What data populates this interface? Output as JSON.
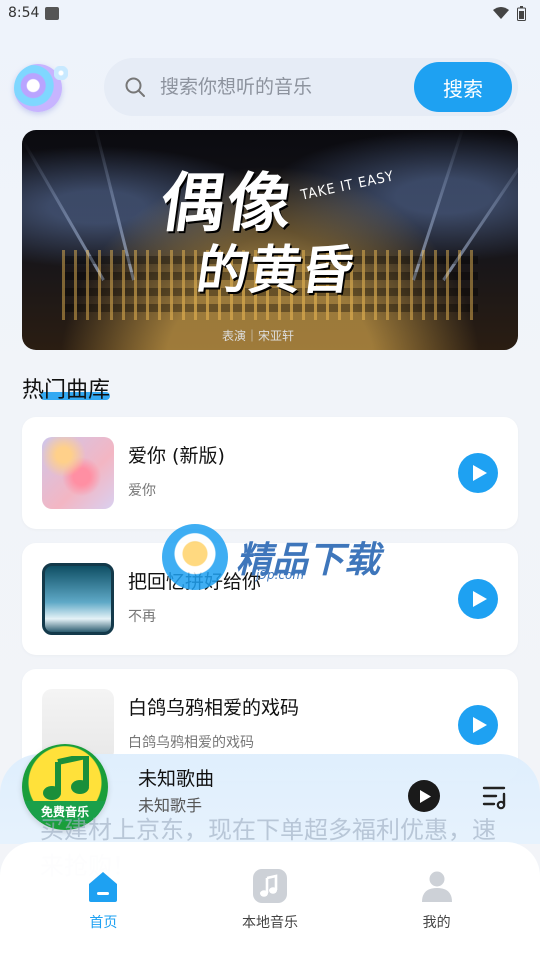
{
  "status_bar": {
    "time": "8:54"
  },
  "header": {
    "search_placeholder": "搜索你想听的音乐",
    "search_button": "搜索"
  },
  "banner": {
    "title_line1": "偶像",
    "title_line2": "的黄昏",
    "subtitle": "TAKE IT EASY",
    "credit": "表演｜宋亚轩"
  },
  "section": {
    "title": "热门曲库"
  },
  "songs": [
    {
      "title": "爱你 (新版)",
      "artist": "爱你"
    },
    {
      "title": "把回忆拼好给你",
      "artist": "不再"
    },
    {
      "title": "白鸽乌鸦相爱的戏码",
      "artist": "白鸽乌鸦相爱的戏码"
    }
  ],
  "watermark": {
    "text": "精品下载",
    "url": "j9p.com"
  },
  "mini_player": {
    "badge_label": "免费音乐",
    "title": "未知歌曲",
    "artist": "未知歌手"
  },
  "ad": {
    "text": "买建材上京东，现在下单超多福利优惠，速来抢购！"
  },
  "nav": [
    {
      "label": "首页",
      "icon": "home-icon",
      "active": true
    },
    {
      "label": "本地音乐",
      "icon": "music-note-icon",
      "active": false
    },
    {
      "label": "我的",
      "icon": "user-icon",
      "active": false
    }
  ],
  "colors": {
    "accent": "#1ea1f2",
    "background": "#f2f4f8"
  }
}
